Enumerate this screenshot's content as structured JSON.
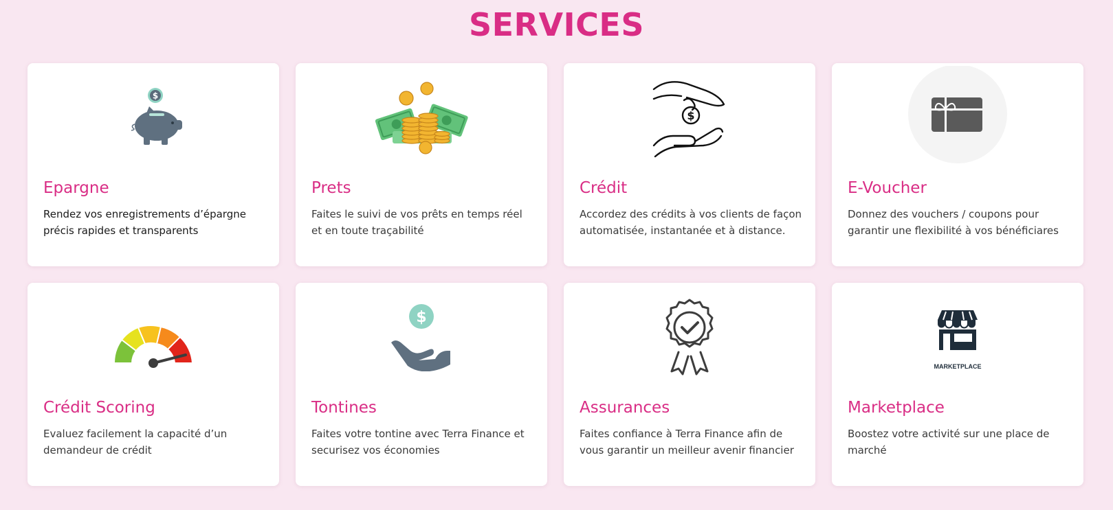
{
  "page": {
    "title": "SERVICES",
    "accent_color": "#d92d85",
    "background_color": "#f9e7f1"
  },
  "services": [
    {
      "id": "epargne",
      "icon": "piggy-bank-icon",
      "title": "Epargne",
      "description": "Rendez vos enregistrements d’épargne précis rapides et transparents"
    },
    {
      "id": "prets",
      "icon": "money-stack-icon",
      "title": "Prets",
      "description": "Faites le suivi de vos prêts en temps réel et en toute traçabilité"
    },
    {
      "id": "credit",
      "icon": "hands-coin-icon",
      "title": "Crédit",
      "description": "Accordez des crédits à vos clients de façon automatisée, instantanée et à distance."
    },
    {
      "id": "evoucher",
      "icon": "gift-card-icon",
      "title": "E-Voucher",
      "description": "Donnez des vouchers / coupons pour garantir une flexibilité à vos bénéficiares"
    },
    {
      "id": "credit-scoring",
      "icon": "gauge-meter-icon",
      "title": "Crédit Scoring",
      "description": "Evaluez facilement la capacité d’un demandeur de crédit"
    },
    {
      "id": "tontines",
      "icon": "hand-dollar-icon",
      "title": "Tontines",
      "description": "Faites votre tontine avec Terra Finance et securisez vos économies"
    },
    {
      "id": "assurances",
      "icon": "award-badge-icon",
      "title": "Assurances",
      "description": "Faites confiance à Terra Finance afin de vous garantir un meilleur avenir financier"
    },
    {
      "id": "marketplace",
      "icon": "storefront-icon",
      "title": "Marketplace",
      "icon_caption": "MARKETPLACE",
      "description": "Boostez votre activité sur une place de marché"
    }
  ]
}
